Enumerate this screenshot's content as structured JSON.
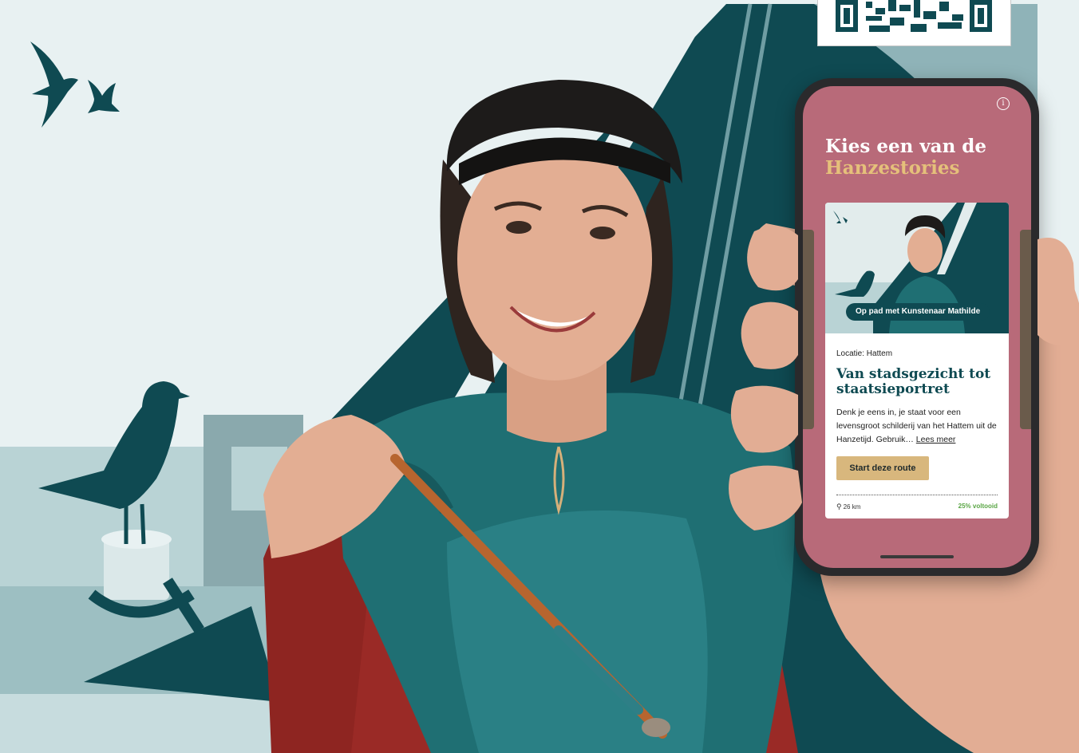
{
  "phone": {
    "headline_line1": "Kies een van de",
    "headline_line2": "Hanzestories",
    "card": {
      "route_label": "Op pad met Kunstenaar Mathilde",
      "location": "Locatie: Hattem",
      "title": "Van stadsgezicht tot staatsieportret",
      "description": "Denk je eens in, je staat voor een levensgroot schilderij van het Hattem uit de Hanzetijd. Gebruik…",
      "read_more": "Lees meer",
      "start_button": "Start deze route",
      "distance": "26 km",
      "progress": "25% voltooid"
    },
    "info_icon": "info-icon",
    "distance_icon": "bike-icon"
  },
  "colors": {
    "teal_dark": "#0f4a52",
    "sky": "#e8f1f2",
    "phone_bg": "#b86a79",
    "accent_gold": "#e5c07a",
    "button": "#d8b77d",
    "progress_green": "#5aa645"
  }
}
